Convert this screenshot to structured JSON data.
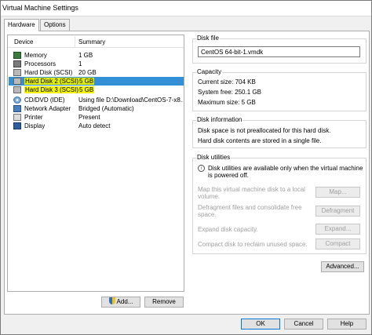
{
  "window": {
    "title": "Virtual Machine Settings"
  },
  "tabs": [
    {
      "label": "Hardware"
    },
    {
      "label": "Options"
    }
  ],
  "device_list": {
    "columns": {
      "device": "Device",
      "summary": "Summary"
    },
    "rows": [
      {
        "device": "Memory",
        "summary": "1 GB",
        "icon": "memory-icon"
      },
      {
        "device": "Processors",
        "summary": "1",
        "icon": "processor-icon"
      },
      {
        "device": "Hard Disk (SCSI)",
        "summary": "20 GB",
        "icon": "hard-disk-icon"
      },
      {
        "device": "Hard Disk 2 (SCSI)",
        "summary": "5 GB",
        "icon": "hard-disk-icon"
      },
      {
        "device": "Hard Disk 3 (SCSI)",
        "summary": "5 GB",
        "icon": "hard-disk-icon"
      },
      {
        "device": "CD/DVD (IDE)",
        "summary": "Using file D:\\Download\\CentOS-7-x8...",
        "icon": "cd-dvd-icon"
      },
      {
        "device": "Network Adapter",
        "summary": "Bridged (Automatic)",
        "icon": "network-adapter-icon"
      },
      {
        "device": "Printer",
        "summary": "Present",
        "icon": "printer-icon"
      },
      {
        "device": "Display",
        "summary": "Auto detect",
        "icon": "display-icon"
      }
    ]
  },
  "list_buttons": {
    "add": "Add...",
    "remove": "Remove"
  },
  "disk_file": {
    "title": "Disk file",
    "value": "CentOS 64-bit-1.vmdk"
  },
  "capacity": {
    "title": "Capacity",
    "current": "Current size: 704 KB",
    "system_free": "System free: 250.1 GB",
    "maximum": "Maximum size: 5 GB"
  },
  "disk_information": {
    "title": "Disk information",
    "line1": "Disk space is not preallocated for this hard disk.",
    "line2": "Hard disk contents are stored in a single file."
  },
  "disk_utilities": {
    "title": "Disk utilities",
    "notice_line1": "Disk utilities are available only when the virtual machine",
    "notice_line2": "is powered off.",
    "map_line1": "Map this virtual machine disk to a local",
    "map_line2": "volume.",
    "map_button": "Map...",
    "defrag_line1": "Defragment files and consolidate free",
    "defrag_line2": "space.",
    "defrag_button": "Defragment",
    "expand_text": "Expand disk capacity.",
    "expand_button": "Expand...",
    "compact_text": "Compact disk to reclaim unused space.",
    "compact_button": "Compact"
  },
  "advanced_button": "Advanced...",
  "footer": {
    "ok": "OK",
    "cancel": "Cancel",
    "help": "Help"
  },
  "colors": {
    "selection": "#3390d6",
    "highlight": "#f4f40a"
  }
}
